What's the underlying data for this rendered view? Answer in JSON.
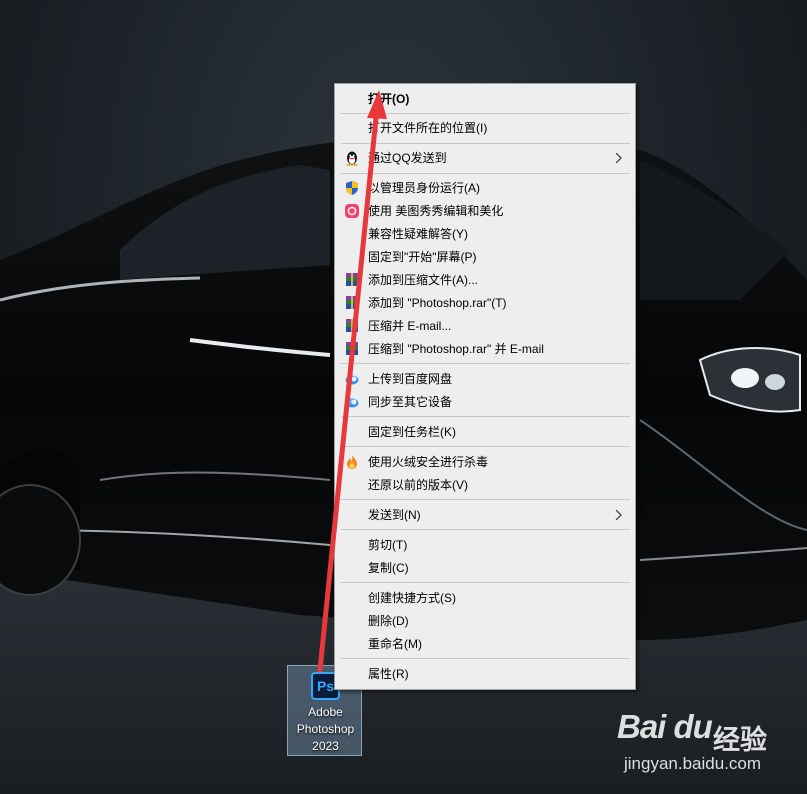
{
  "desktop_icon": {
    "app_name": "Adobe Photoshop 2023",
    "logo_text": "Ps"
  },
  "context_menu": {
    "items": [
      {
        "label": "打开(O)",
        "bold": true,
        "icon": "none"
      },
      {
        "label": "打开文件所在的位置(I)",
        "icon": "none"
      },
      {
        "label": "通过QQ发送到",
        "icon": "qq-penguin-icon",
        "submenu": true
      },
      {
        "label": "以管理员身份运行(A)",
        "icon": "uac-shield-icon"
      },
      {
        "label": "使用 美图秀秀编辑和美化",
        "icon": "meitu-icon"
      },
      {
        "label": "兼容性疑难解答(Y)",
        "icon": "none"
      },
      {
        "label": "固定到\"开始\"屏幕(P)",
        "icon": "none"
      },
      {
        "label": "添加到压缩文件(A)...",
        "icon": "winrar-icon"
      },
      {
        "label": "添加到 \"Photoshop.rar\"(T)",
        "icon": "winrar-icon"
      },
      {
        "label": "压缩并 E-mail...",
        "icon": "winrar-icon"
      },
      {
        "label": "压缩到 \"Photoshop.rar\" 并 E-mail",
        "icon": "winrar-icon"
      },
      {
        "label": "上传到百度网盘",
        "icon": "baidu-netdisk-icon"
      },
      {
        "label": "同步至其它设备",
        "icon": "baidu-netdisk-icon"
      },
      {
        "label": "固定到任务栏(K)",
        "icon": "none"
      },
      {
        "label": "使用火绒安全进行杀毒",
        "icon": "huorong-icon"
      },
      {
        "label": "还原以前的版本(V)",
        "icon": "none"
      },
      {
        "label": "发送到(N)",
        "icon": "none",
        "submenu": true
      },
      {
        "label": "剪切(T)",
        "icon": "none"
      },
      {
        "label": "复制(C)",
        "icon": "none"
      },
      {
        "label": "创建快捷方式(S)",
        "icon": "none"
      },
      {
        "label": "删除(D)",
        "icon": "none"
      },
      {
        "label": "重命名(M)",
        "icon": "none"
      },
      {
        "label": "属性(R)",
        "icon": "none"
      }
    ]
  },
  "watermark": {
    "brand": "Bai du",
    "product": "经验",
    "url": "jingyan.baidu.com"
  },
  "colors": {
    "menu_bg": "#eeeeee",
    "annotation_arrow": "#e8383b",
    "ps_blue": "#31a8ff"
  }
}
